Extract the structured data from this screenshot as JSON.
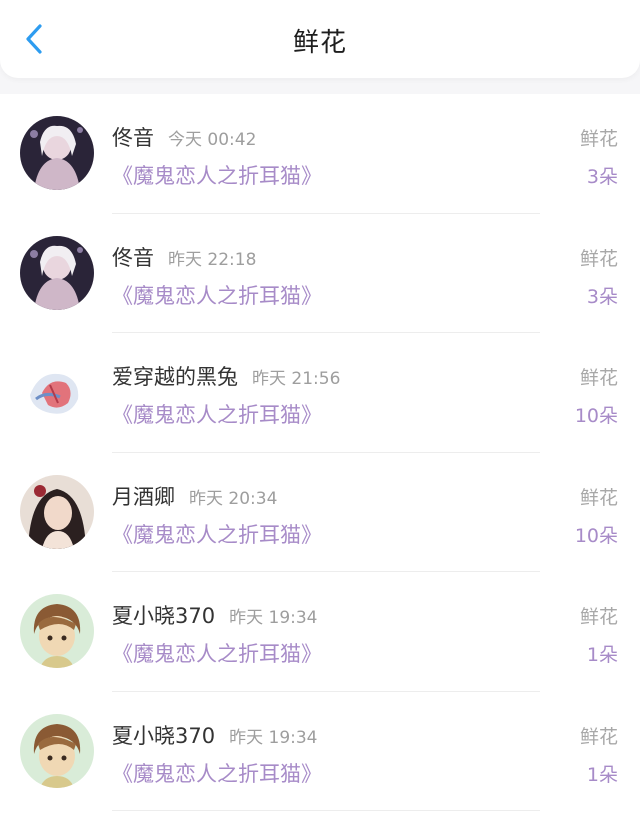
{
  "header": {
    "title": "鲜花",
    "back_icon": "chevron-left-icon"
  },
  "colors": {
    "accent_purple": "#a78bc8",
    "back_blue": "#2d9cf0"
  },
  "records": [
    {
      "user": "佟音",
      "time": "今天 00:42",
      "book": "《魔鬼恋人之折耳猫》",
      "gift": "鲜花",
      "count": "3朵"
    },
    {
      "user": "佟音",
      "time": "昨天 22:18",
      "book": "《魔鬼恋人之折耳猫》",
      "gift": "鲜花",
      "count": "3朵"
    },
    {
      "user": "爱穿越的黑兔",
      "time": "昨天 21:56",
      "book": "《魔鬼恋人之折耳猫》",
      "gift": "鲜花",
      "count": "10朵"
    },
    {
      "user": "月酒卿",
      "time": "昨天 20:34",
      "book": "《魔鬼恋人之折耳猫》",
      "gift": "鲜花",
      "count": "10朵"
    },
    {
      "user": "夏小晓370",
      "time": "昨天 19:34",
      "book": "《魔鬼恋人之折耳猫》",
      "gift": "鲜花",
      "count": "1朵"
    },
    {
      "user": "夏小晓370",
      "time": "昨天 19:34",
      "book": "《魔鬼恋人之折耳猫》",
      "gift": "鲜花",
      "count": "1朵"
    }
  ]
}
